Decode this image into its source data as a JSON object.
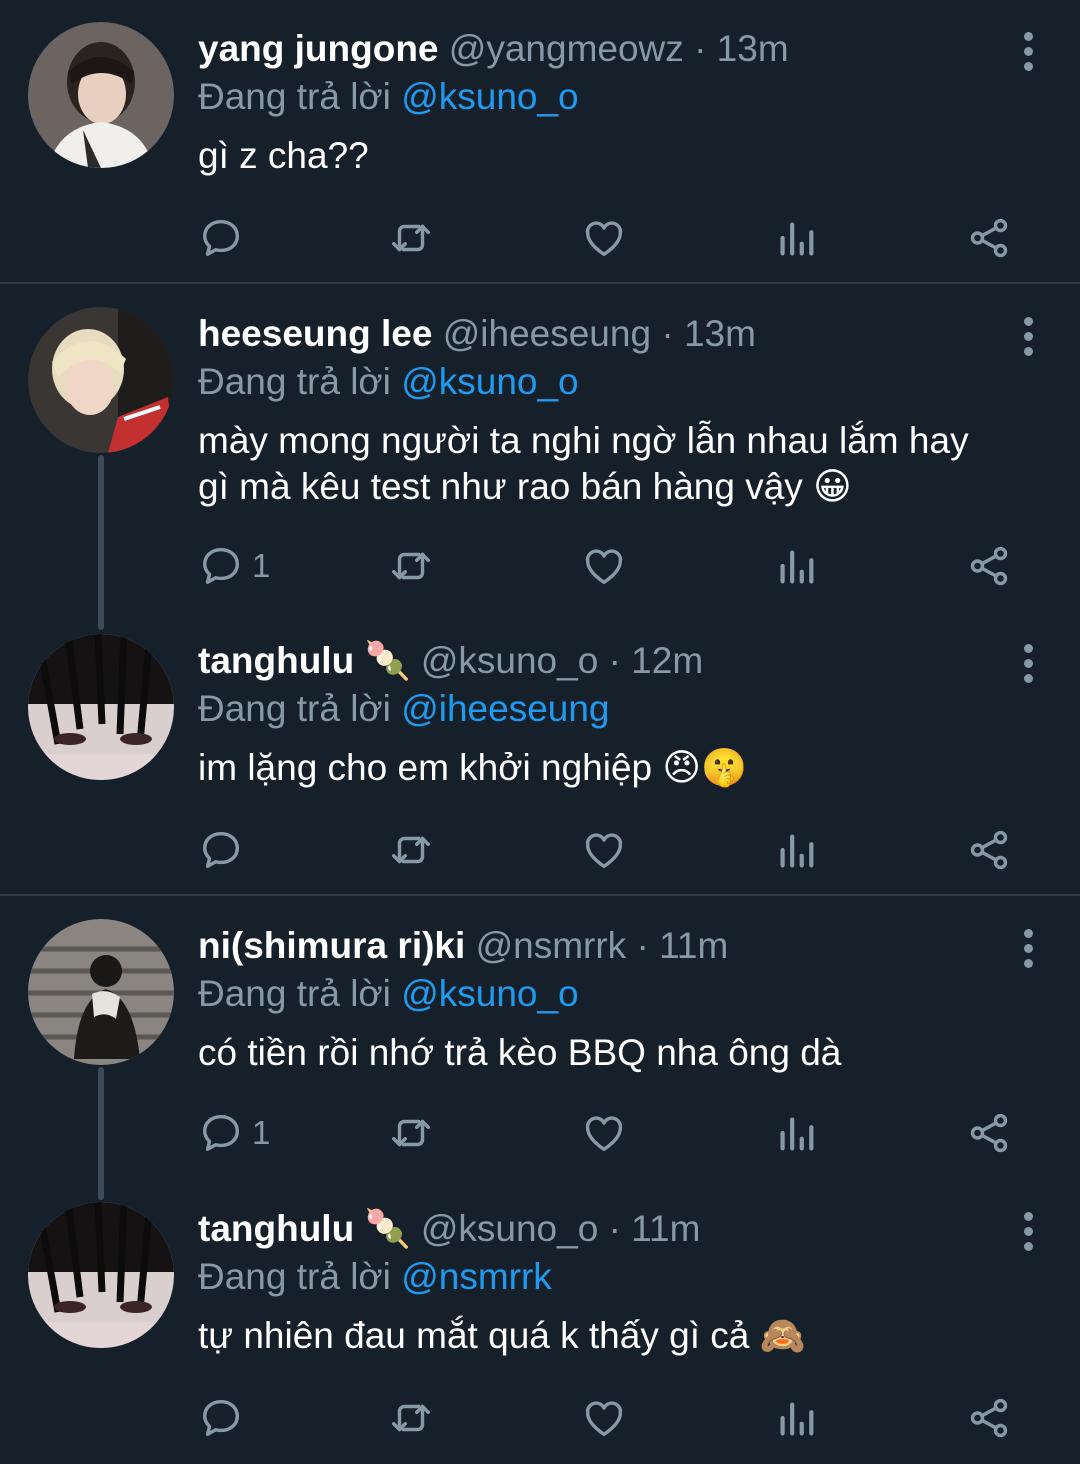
{
  "reply_prefix": "Đang trả lời",
  "tweets": [
    {
      "name": "yang jungone",
      "handle": "@yangmeowz",
      "time": "13m",
      "replying_to": "@ksuno_o",
      "text": "gì z cha??",
      "reply_count": ""
    },
    {
      "name": "heeseung lee",
      "handle": "@iheeseung",
      "time": "13m",
      "replying_to": "@ksuno_o",
      "text": "mày mong người ta nghi ngờ lẫn nhau lắm hay gì mà kêu test như rao bán hàng vậy 😀",
      "reply_count": "1"
    },
    {
      "name": "tanghulu",
      "name_emoji": "🍡",
      "handle": "@ksuno_o",
      "time": "12m",
      "replying_to": "@iheeseung",
      "text": "im lặng cho em khởi nghiệp 😠🤫",
      "reply_count": ""
    },
    {
      "name": "ni(shimura ri)ki",
      "handle": "@nsmrrk",
      "time": "11m",
      "replying_to": "@ksuno_o",
      "text": "có tiền rồi nhớ trả kèo BBQ nha ông dà",
      "reply_count": "1"
    },
    {
      "name": "tanghulu",
      "name_emoji": "🍡",
      "handle": "@ksuno_o",
      "time": "11m",
      "replying_to": "@nsmrrk",
      "text": "tự nhiên đau mắt quá k thấy gì cả 🙈",
      "reply_count": ""
    }
  ],
  "colors": {
    "background": "#15202b",
    "secondary_text": "#8899a6",
    "mention": "#1d9bf0",
    "divider": "#2f3b47"
  }
}
